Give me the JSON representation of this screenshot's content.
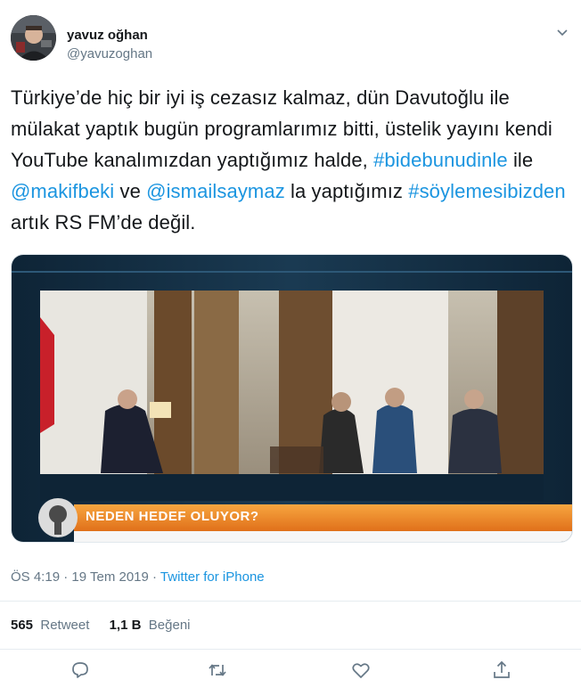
{
  "tweet": {
    "author": {
      "name": "yavuz oğhan",
      "handle": "@yavuzoghan"
    },
    "text_segments": [
      {
        "text": "Türkiye’de hiç bir iyi iş cezasız kalmaz, dün Davutoğlu ile mülakat yaptık bugün programlarımız bitti, üstelik yayını kendi YouTube kanalımızdan yaptığımız halde, ",
        "link": false
      },
      {
        "text": "#bidebunudinle",
        "link": true
      },
      {
        "text": " ile ",
        "link": false
      },
      {
        "text": "@makifbeki",
        "link": true
      },
      {
        "text": " ve ",
        "link": false
      },
      {
        "text": "@ismailsaymaz",
        "link": true
      },
      {
        "text": " la yaptığımız ",
        "link": false
      },
      {
        "text": "#söylemesibizden",
        "link": true
      },
      {
        "text": " artık RS FM’de değil.",
        "link": false
      }
    ],
    "media": {
      "banner": "NEDEN HEDEF OLUYOR?"
    },
    "meta": {
      "time": "ÖS 4:19",
      "dot1": " · ",
      "date": "19 Tem 2019",
      "dot2": " · ",
      "source": "Twitter for iPhone"
    },
    "stats": {
      "retweets_count": "565",
      "retweets_label": "Retweet",
      "likes_count": "1,1 B",
      "likes_label": "Beğeni"
    }
  },
  "icons": {
    "caret": "chevron-down-icon",
    "reply": "reply-icon",
    "retweet": "retweet-icon",
    "like": "heart-icon",
    "share": "share-icon"
  },
  "colors": {
    "link": "#1b95e0",
    "secondary": "#657786",
    "text": "#14171a",
    "banner": "#f08c1e"
  }
}
